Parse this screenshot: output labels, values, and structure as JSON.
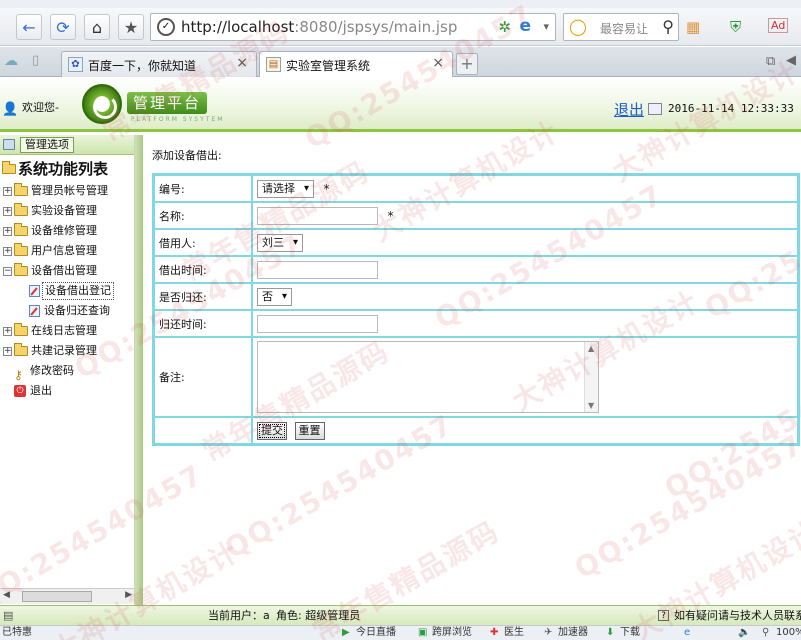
{
  "browser": {
    "url_host": "http://localhost",
    "url_rest": ":8080/jspsys/main.jsp",
    "search_placeholder": "最容易让",
    "tabs": [
      {
        "title": "百度一下，你就知道",
        "active": false
      },
      {
        "title": "实验室管理系统",
        "active": true
      }
    ],
    "status_items": [
      "已特惠",
      "今日直播",
      "跨屏浏览",
      "医生",
      "加速器",
      "下载",
      "100%"
    ]
  },
  "header": {
    "welcome": "欢迎您-",
    "brand": "管理平台",
    "brand_sub": "PLATFORM SYSYTEM",
    "logout": "退出",
    "datetime": "2016-11-14 12:33:33 F"
  },
  "sidebar": {
    "header_label": "管理选项",
    "root_label": "系统功能列表",
    "items": [
      {
        "label": "管理员帐号管理",
        "type": "folder",
        "expanded": false
      },
      {
        "label": "实验设备管理",
        "type": "folder",
        "expanded": false
      },
      {
        "label": "设备维修管理",
        "type": "folder",
        "expanded": false
      },
      {
        "label": "用户信息管理",
        "type": "folder",
        "expanded": false
      },
      {
        "label": "设备借出管理",
        "type": "folder",
        "expanded": true
      },
      {
        "label": "设备借出登记",
        "type": "leaf",
        "selected": true
      },
      {
        "label": "设备归还查询",
        "type": "leaf",
        "selected": false
      },
      {
        "label": "在线日志管理",
        "type": "folder",
        "expanded": false
      },
      {
        "label": "共建记录管理",
        "type": "folder",
        "expanded": false
      },
      {
        "label": "修改密码",
        "type": "key"
      },
      {
        "label": "退出",
        "type": "exit"
      }
    ]
  },
  "form": {
    "title": "添加设备借出:",
    "fields": {
      "code_label": "编号:",
      "code_value": "请选择",
      "name_label": "名称:",
      "name_value": "",
      "borrower_label": "借用人:",
      "borrower_value": "刘三",
      "borrow_time_label": "借出时间:",
      "borrow_time_value": "",
      "returned_label": "是否归还:",
      "returned_value": "否",
      "return_time_label": "归还时间:",
      "return_time_value": "",
      "remark_label": "备注:",
      "remark_value": ""
    },
    "required_mark": "*",
    "submit": "提交",
    "reset": "重置"
  },
  "footer": {
    "current_user": "当前用户：a",
    "role": "角色: 超级管理员",
    "help": "如有疑问请与技术人员联系"
  },
  "watermark": {
    "qq": "QQ:254540457",
    "text1": "大神计算机设计",
    "text2": "常年售精品源码"
  }
}
